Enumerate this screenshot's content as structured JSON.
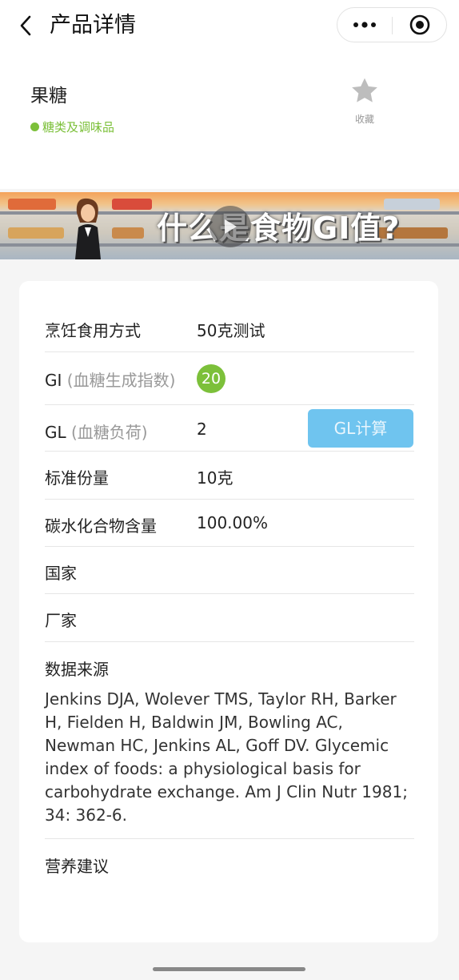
{
  "navbar": {
    "title": "产品详情",
    "back_icon": "chevron-left-icon",
    "more_icon": "more-dots-icon",
    "close_icon": "target-circle-icon"
  },
  "product": {
    "name": "果糖",
    "category": "糖类及调味品",
    "category_color": "#7cc03a",
    "favorite_label": "收藏"
  },
  "banner": {
    "text": "什么是食物GI值?"
  },
  "details": {
    "cooking": {
      "label": "烹饪食用方式",
      "value": "50克测试"
    },
    "gi": {
      "label": "GI",
      "sub": "(血糖生成指数)",
      "value": "20"
    },
    "gl": {
      "label": "GL",
      "sub": "(血糖负荷)",
      "value": "2",
      "button": "GL计算"
    },
    "serving": {
      "label": "标准份量",
      "value": "10克"
    },
    "carbs": {
      "label": "碳水化合物含量",
      "value": "100.00%"
    },
    "country": {
      "label": "国家",
      "value": ""
    },
    "manufacturer": {
      "label": "厂家",
      "value": ""
    },
    "source": {
      "label": "数据来源",
      "value": "Jenkins DJA, Wolever TMS, Taylor RH, Barker H, Fielden H, Baldwin JM, Bowling AC, Newman HC, Jenkins AL, Goff DV. Glycemic index of foods: a physiological basis for carbohydrate exchange. Am J Clin Nutr 1981; 34: 362-6."
    },
    "advice": {
      "label": "营养建议",
      "value": ""
    }
  },
  "colors": {
    "accent_green": "#7cc03a",
    "gl_button": "#6fc4ef"
  }
}
